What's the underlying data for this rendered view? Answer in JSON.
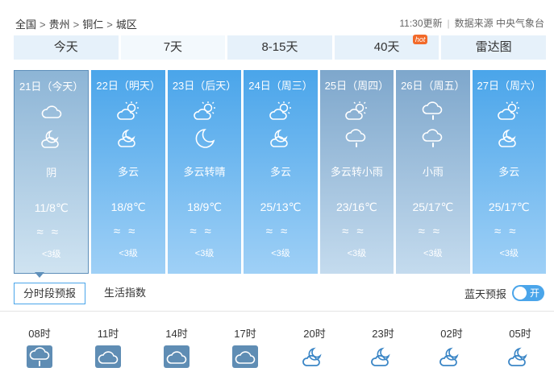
{
  "breadcrumb": {
    "items": [
      "全国",
      "贵州",
      "铜仁",
      "城区"
    ],
    "separator": ">"
  },
  "source": {
    "updated": "11:30更新",
    "separator": "|",
    "label": "数据来源 中央气象台"
  },
  "tabs": [
    {
      "label": "今天",
      "active": false
    },
    {
      "label": "7天",
      "active": true
    },
    {
      "label": "8-15天",
      "active": false
    },
    {
      "label": "40天",
      "active": false,
      "badge": "hot"
    },
    {
      "label": "雷达图",
      "active": false
    }
  ],
  "days": [
    {
      "date": "21日（今天）",
      "icon_day": "cloud-icon",
      "icon_night": "cloudy-night-icon",
      "weather": "阴",
      "temp": "11/8℃",
      "wind": "≈≈",
      "level": "<3级"
    },
    {
      "date": "22日（明天）",
      "icon_day": "partly-cloudy-day-icon",
      "icon_night": "cloudy-night-icon",
      "weather": "多云",
      "temp": "18/8℃",
      "wind": "≈≈",
      "level": "<3级"
    },
    {
      "date": "23日（后天）",
      "icon_day": "partly-cloudy-day-icon",
      "icon_night": "moon-icon",
      "weather": "多云转晴",
      "temp": "18/9℃",
      "wind": "≈≈",
      "level": "<3级"
    },
    {
      "date": "24日（周三）",
      "icon_day": "partly-cloudy-day-icon",
      "icon_night": "cloudy-night-icon",
      "weather": "多云",
      "temp": "25/13℃",
      "wind": "≈≈",
      "level": "<3级"
    },
    {
      "date": "25日（周四）",
      "icon_day": "partly-cloudy-day-icon",
      "icon_night": "light-rain-icon",
      "weather": "多云转小雨",
      "temp": "23/16℃",
      "wind": "≈≈",
      "level": "<3级"
    },
    {
      "date": "26日（周五）",
      "icon_day": "light-rain-icon",
      "icon_night": "light-rain-icon",
      "weather": "小雨",
      "temp": "25/17℃",
      "wind": "≈≈",
      "level": "<3级"
    },
    {
      "date": "27日（周六）",
      "icon_day": "partly-cloudy-day-icon",
      "icon_night": "cloudy-night-icon",
      "weather": "多云",
      "temp": "25/17℃",
      "wind": "≈≈",
      "level": "<3级"
    }
  ],
  "subtabs": {
    "hourly": "分时段预报",
    "indices": "生活指数"
  },
  "toggle": {
    "label": "蓝天预报",
    "state": "开"
  },
  "hourly": [
    {
      "time": "08时",
      "icon": "light-rain-icon"
    },
    {
      "time": "11时",
      "icon": "cloud-icon"
    },
    {
      "time": "14时",
      "icon": "cloud-icon"
    },
    {
      "time": "17时",
      "icon": "cloud-icon"
    },
    {
      "time": "20时",
      "icon": "cloudy-night-icon"
    },
    {
      "time": "23时",
      "icon": "cloudy-night-icon"
    },
    {
      "time": "02时",
      "icon": "cloudy-night-icon"
    },
    {
      "time": "05时",
      "icon": "cloudy-night-icon"
    }
  ],
  "colors": {
    "accent": "#4aa5ea",
    "tab_bg": "#e6f1fa",
    "past_day_bg": "#9bbfdc",
    "hour_icon_stroke": "#3b86c6"
  }
}
